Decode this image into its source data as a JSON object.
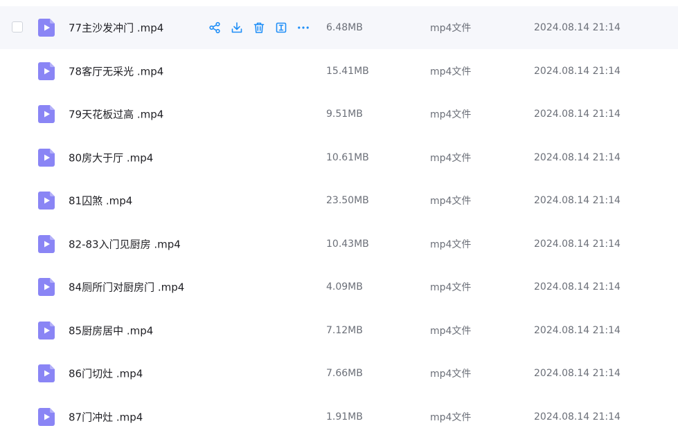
{
  "colors": {
    "accent": "#1e8ef7",
    "video_icon": "#8a85f5",
    "hover_row_bg": "#f6f7fb",
    "name_text": "#1f1f24",
    "meta_text": "#6b6f78"
  },
  "row_actions": [
    {
      "icon": "share-icon"
    },
    {
      "icon": "download-icon"
    },
    {
      "icon": "delete-icon"
    },
    {
      "icon": "rename-icon"
    },
    {
      "icon": "more-icon"
    }
  ],
  "files": [
    {
      "name": "77主沙发冲门 .mp4",
      "size": "6.48MB",
      "type": "mp4文件",
      "date": "2024.08.14 21:14",
      "hovered": true
    },
    {
      "name": "78客厅无采光 .mp4",
      "size": "15.41MB",
      "type": "mp4文件",
      "date": "2024.08.14 21:14"
    },
    {
      "name": "79天花板过高 .mp4",
      "size": "9.51MB",
      "type": "mp4文件",
      "date": "2024.08.14 21:14"
    },
    {
      "name": "80房大于厅 .mp4",
      "size": "10.61MB",
      "type": "mp4文件",
      "date": "2024.08.14 21:14"
    },
    {
      "name": "81囚煞 .mp4",
      "size": "23.50MB",
      "type": "mp4文件",
      "date": "2024.08.14 21:14"
    },
    {
      "name": "82-83入门见厨房 .mp4",
      "size": "10.43MB",
      "type": "mp4文件",
      "date": "2024.08.14 21:14"
    },
    {
      "name": "84厕所门对厨房门 .mp4",
      "size": "4.09MB",
      "type": "mp4文件",
      "date": "2024.08.14 21:14"
    },
    {
      "name": "85厨房居中 .mp4",
      "size": "7.12MB",
      "type": "mp4文件",
      "date": "2024.08.14 21:14"
    },
    {
      "name": "86门切灶 .mp4",
      "size": "7.66MB",
      "type": "mp4文件",
      "date": "2024.08.14 21:14"
    },
    {
      "name": "87门冲灶 .mp4",
      "size": "1.91MB",
      "type": "mp4文件",
      "date": "2024.08.14 21:14"
    }
  ]
}
